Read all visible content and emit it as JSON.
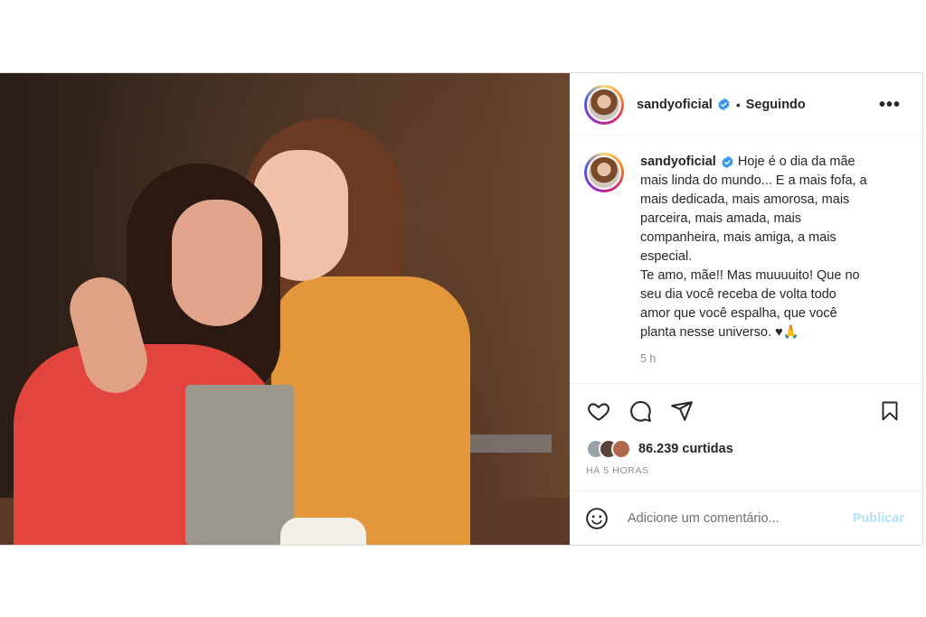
{
  "post": {
    "username": "sandyoficial",
    "separator": "•",
    "follow_status": "Seguindo",
    "more_label": "•••",
    "caption_lines": [
      "Hoje é o dia da mãe",
      "mais linda do mundo... E a mais fofa, a",
      "mais dedicada, mais amorosa, mais",
      "parceira, mais amada, mais",
      "companheira, mais amiga, a mais",
      "especial.",
      "Te amo, mãe!! Mas muuuuito! Que no",
      "seu dia você receba de volta todo",
      "amor que você espalha, que você",
      "planta nesse universo. ♥🙏"
    ],
    "caption_time": "5 h",
    "likes_text": "86.239 curtidas",
    "posted_ago": "HÁ 5 HORAS",
    "comment_placeholder": "Adicione um comentário...",
    "publish_label": "Publicar"
  },
  "icons": [
    "verified-badge-icon",
    "heart-icon",
    "comment-icon",
    "share-icon",
    "bookmark-icon",
    "emoji-icon",
    "more-options-icon"
  ],
  "colors": {
    "verified": "#3897f0",
    "publish_disabled": "#b2dffc",
    "secondary_text": "#8e8e8e",
    "border": "#dbdbdb"
  }
}
